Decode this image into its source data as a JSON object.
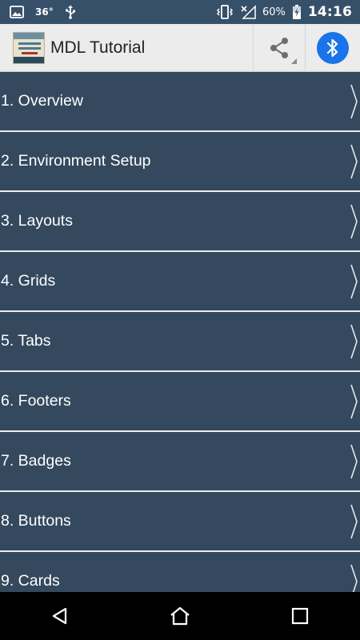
{
  "status_bar": {
    "temperature": "36°",
    "battery_percent": "60%",
    "time": "14:16",
    "left_icons": [
      "image-icon",
      "usb-icon"
    ],
    "right_icons": [
      "vibrate-icon",
      "no-signal-icon",
      "battery-charging-icon"
    ]
  },
  "app_bar": {
    "title": "MDL Tutorial",
    "actions": [
      "share-icon",
      "bluetooth-icon"
    ],
    "colors": {
      "background": "#ececec",
      "bluetooth_accent": "#1a73e8"
    }
  },
  "list": {
    "items": [
      {
        "label": "1. Overview"
      },
      {
        "label": "2. Environment Setup"
      },
      {
        "label": "3. Layouts"
      },
      {
        "label": "4. Grids"
      },
      {
        "label": "5. Tabs"
      },
      {
        "label": "6. Footers"
      },
      {
        "label": "7. Badges"
      },
      {
        "label": "8. Buttons"
      },
      {
        "label": "9. Cards"
      }
    ],
    "colors": {
      "background": "#34495e",
      "divider": "#e8ecef",
      "text": "#ffffff"
    }
  },
  "nav_bar": {
    "buttons": [
      "back-icon",
      "home-icon",
      "recents-icon"
    ]
  }
}
